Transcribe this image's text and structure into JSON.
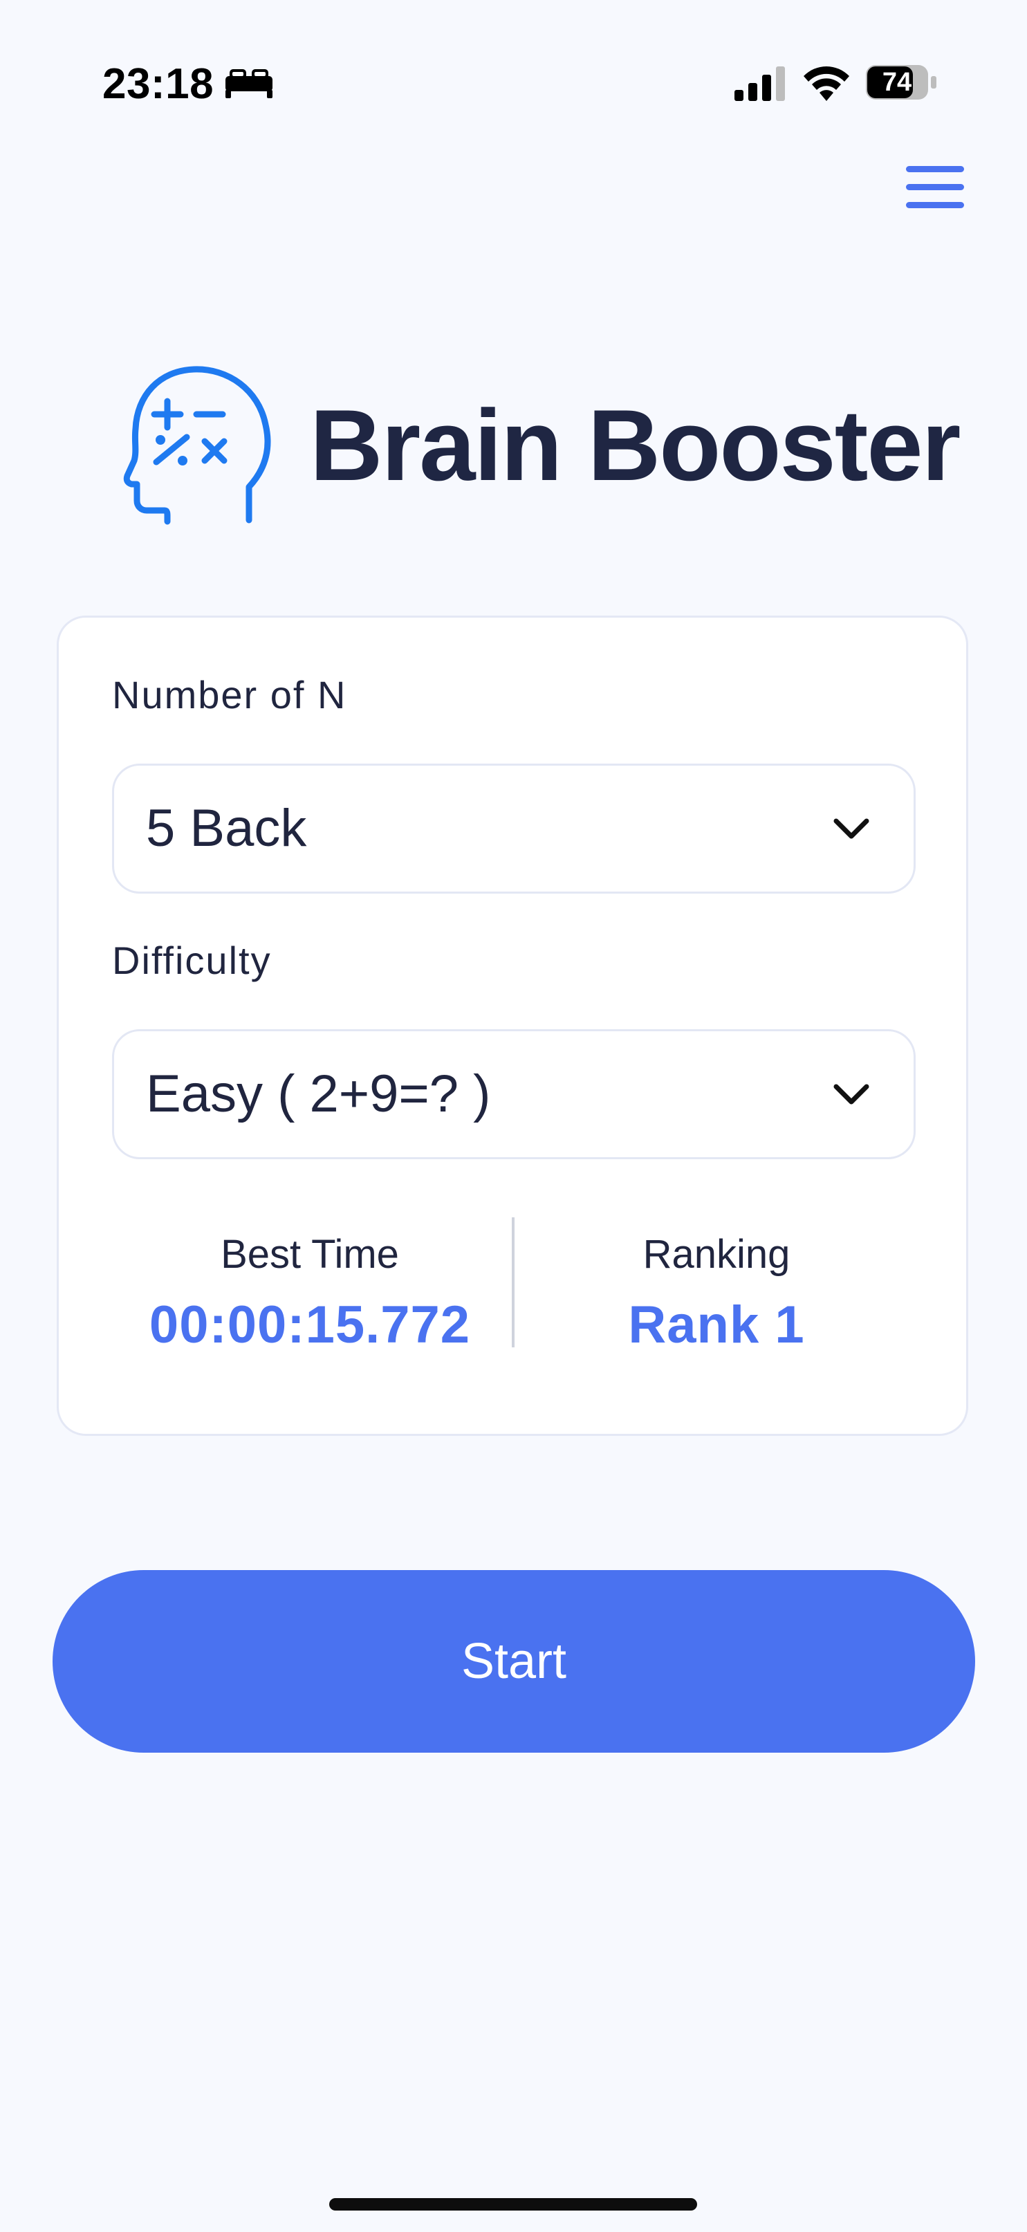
{
  "status_bar": {
    "time": "23:18",
    "battery": "74",
    "icons": [
      "bed-icon",
      "signal-icon",
      "wifi-icon",
      "battery-icon"
    ]
  },
  "header": {
    "menu_icon": "hamburger-menu-icon",
    "app_title": "Brain Booster",
    "logo_icon": "brain-head-math-icon"
  },
  "settings": {
    "n_back": {
      "label": "Number of N",
      "value": "5 Back"
    },
    "difficulty": {
      "label": "Difficulty",
      "value": "Easy ( 2+9=? )"
    }
  },
  "stats": {
    "best_time": {
      "label": "Best Time",
      "value": "00:00:15.772"
    },
    "ranking": {
      "label": "Ranking",
      "value": "Rank 1"
    }
  },
  "actions": {
    "start_label": "Start"
  },
  "colors": {
    "accent": "#4a72f0",
    "background": "#f7f9fe",
    "text": "#20253f",
    "logo_blue": "#1f7af0"
  }
}
